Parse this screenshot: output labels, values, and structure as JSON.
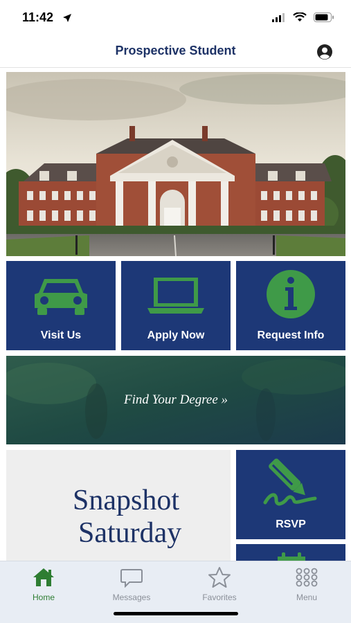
{
  "status": {
    "time": "11:42"
  },
  "nav": {
    "title": "Prospective Student"
  },
  "tiles": [
    {
      "label": "Visit Us",
      "icon": "car-icon"
    },
    {
      "label": "Apply Now",
      "icon": "laptop-icon"
    },
    {
      "label": "Request Info",
      "icon": "info-icon"
    }
  ],
  "degree": {
    "label": "Find Your Degree »"
  },
  "snapshot": {
    "line1": "Snapshot",
    "line2": "Saturday"
  },
  "rsvp": {
    "label": "RSVP",
    "icon": "pen-signature-icon"
  },
  "tabbar": {
    "items": [
      {
        "label": "Home",
        "icon": "home-icon",
        "active": true
      },
      {
        "label": "Messages",
        "icon": "chat-bubble-icon",
        "active": false
      },
      {
        "label": "Favorites",
        "icon": "star-icon",
        "active": false
      },
      {
        "label": "Menu",
        "icon": "grid-dots-icon",
        "active": false
      }
    ]
  },
  "colors": {
    "navy": "#1d3877",
    "green": "#3f9a48",
    "active_tab": "#2e7d32"
  }
}
